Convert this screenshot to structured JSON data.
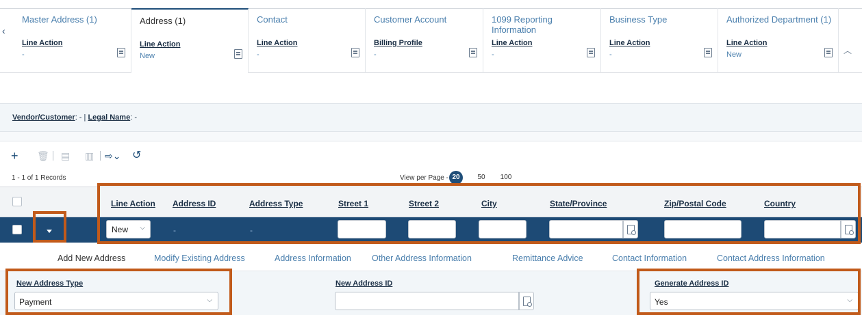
{
  "tabs": [
    {
      "title": "Master Address (1)",
      "field": "Line Action",
      "value": "-"
    },
    {
      "title": "Address (1)",
      "field": "Line Action",
      "value": "New"
    },
    {
      "title": "Contact",
      "field": "Line Action",
      "value": "-"
    },
    {
      "title": "Customer Account",
      "field": "Billing Profile",
      "value": "-"
    },
    {
      "title": "1099 Reporting Information",
      "field": "Line Action",
      "value": "-"
    },
    {
      "title": "Business Type",
      "field": "Line Action",
      "value": "-"
    },
    {
      "title": "Authorized Department (1)",
      "field": "Line Action",
      "value": "New"
    }
  ],
  "vendor": {
    "vendor_label": "Vendor/Customer",
    "vendor_value": ": -",
    "separator": " | ",
    "legal_label": "Legal Name",
    "legal_value": ": -"
  },
  "pager": {
    "records": "1 - 1 of 1 Records",
    "view_per_page": "View per Page -",
    "options": [
      "20",
      "50",
      "100"
    ],
    "selected": "20"
  },
  "grid": {
    "columns": [
      "Line Action",
      "Address ID",
      "Address Type",
      "Street 1",
      "Street 2",
      "City",
      "State/Province",
      "Zip/Postal Code",
      "Country"
    ],
    "row": {
      "line_action": "New",
      "address_id": "-",
      "address_type": "-"
    }
  },
  "section_nav": [
    "Add New Address",
    "Modify Existing Address",
    "Address Information",
    "Other Address Information",
    "Remittance Advice",
    "Contact Information",
    "Contact Address Information"
  ],
  "form": {
    "new_address_type": {
      "label": "New Address Type",
      "value": "Payment"
    },
    "new_address_id": {
      "label": "New Address ID",
      "value": ""
    },
    "generate_address_id": {
      "label": "Generate Address ID",
      "value": "Yes"
    }
  },
  "icons": {
    "add": "plus-icon",
    "delete": "trash-icon",
    "copy": "copy-icon",
    "paste": "paste-icon",
    "export": "export-icon",
    "refresh": "refresh-icon"
  },
  "colors": {
    "accent": "#1f4e79",
    "highlight": "#c15a1a",
    "link": "#4a7fad"
  }
}
